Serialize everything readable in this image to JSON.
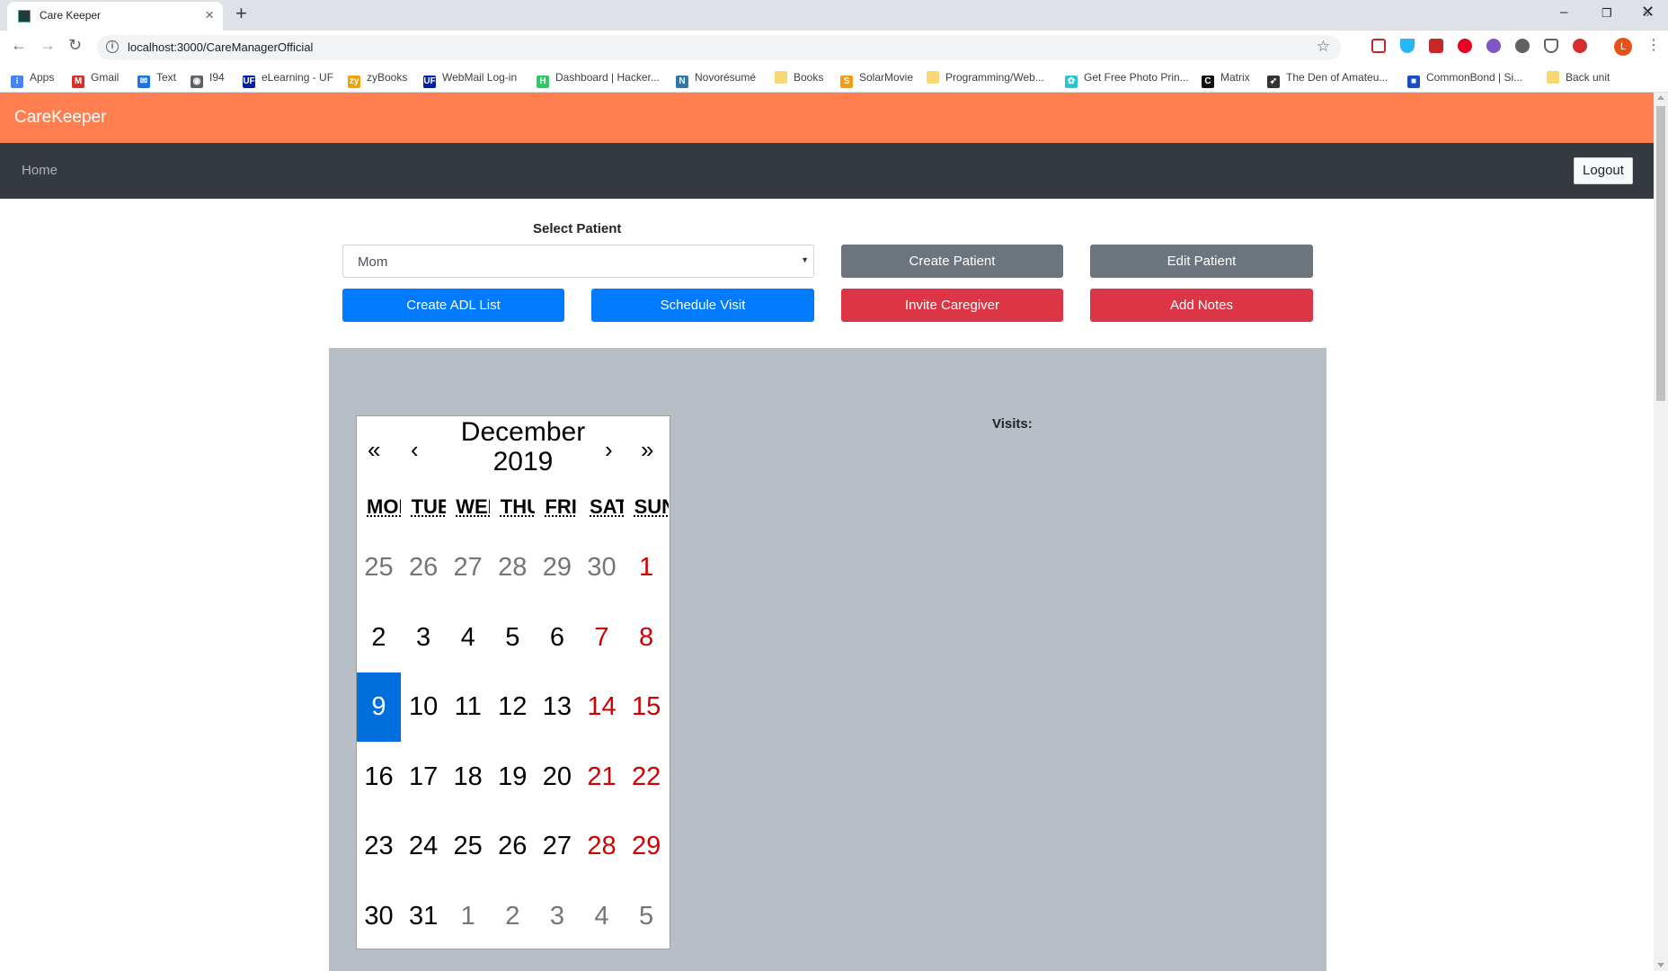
{
  "browser": {
    "tab_title": "Care Keeper",
    "url": "localhost:3000/CareManagerOfficial",
    "profile_initial": "L",
    "bookmarks": [
      {
        "label": "Apps",
        "icon": "apps-grid-icon",
        "color": "#4285f4"
      },
      {
        "label": "Gmail",
        "icon": "gmail-icon",
        "color": "#d93025"
      },
      {
        "label": "Text",
        "icon": "text-icon",
        "color": "#1a73e8"
      },
      {
        "label": "I94",
        "icon": "globe-icon",
        "color": "#5f6368"
      },
      {
        "label": "eLearning - UF",
        "icon": "uf-icon",
        "color": "#0021a5"
      },
      {
        "label": "zyBooks",
        "icon": "zybooks-icon",
        "color": "#f4a100"
      },
      {
        "label": "WebMail Log-in",
        "icon": "uf-icon",
        "color": "#0021a5"
      },
      {
        "label": "Dashboard | Hacker...",
        "icon": "hackerrank-icon",
        "color": "#2ec866"
      },
      {
        "label": "Novorésumé",
        "icon": "novoresume-icon",
        "color": "#2a7ab0"
      },
      {
        "label": "Books",
        "icon": "folder-icon",
        "color": "#f8d775"
      },
      {
        "label": "SolarMovie",
        "icon": "solarmovie-icon",
        "color": "#f39c12"
      },
      {
        "label": "Programming/Web...",
        "icon": "folder-icon",
        "color": "#f8d775"
      },
      {
        "label": "Get Free Photo Prin...",
        "icon": "photo-icon",
        "color": "#26c6da"
      },
      {
        "label": "Matrix",
        "icon": "matrix-icon",
        "color": "#111111"
      },
      {
        "label": "The Den of Amateu...",
        "icon": "bird-icon",
        "color": "#333333"
      },
      {
        "label": "CommonBond | Si...",
        "icon": "commonbond-icon",
        "color": "#1a4fc4"
      },
      {
        "label": "Back unit",
        "icon": "folder-icon",
        "color": "#f8d775"
      }
    ]
  },
  "app": {
    "brand": "CareKeeper",
    "nav_home": "Home",
    "logout": "Logout",
    "brand_color": "#ff7f50"
  },
  "controls": {
    "select_label": "Select Patient",
    "selected_patient": "Mom",
    "buttons": {
      "create_patient": "Create Patient",
      "edit_patient": "Edit Patient",
      "create_adl": "Create ADL List",
      "schedule_visit": "Schedule Visit",
      "invite_caregiver": "Invite Caregiver",
      "add_notes": "Add Notes"
    }
  },
  "visits_label": "Visits:",
  "calendar": {
    "nav": {
      "prev2": "«",
      "prev": "‹",
      "next": "›",
      "next2": "»"
    },
    "month": "December",
    "year": "2019",
    "weekdays": [
      "MON",
      "TUE",
      "WED",
      "THU",
      "FRI",
      "SAT",
      "SUN"
    ],
    "weeks": [
      [
        {
          "d": "25",
          "t": "neighbor"
        },
        {
          "d": "26",
          "t": "neighbor"
        },
        {
          "d": "27",
          "t": "neighbor"
        },
        {
          "d": "28",
          "t": "neighbor"
        },
        {
          "d": "29",
          "t": "neighbor"
        },
        {
          "d": "30",
          "t": "neighbor"
        },
        {
          "d": "1",
          "t": "weekend"
        }
      ],
      [
        {
          "d": "2",
          "t": ""
        },
        {
          "d": "3",
          "t": ""
        },
        {
          "d": "4",
          "t": ""
        },
        {
          "d": "5",
          "t": ""
        },
        {
          "d": "6",
          "t": ""
        },
        {
          "d": "7",
          "t": "weekend"
        },
        {
          "d": "8",
          "t": "weekend"
        }
      ],
      [
        {
          "d": "9",
          "t": "active"
        },
        {
          "d": "10",
          "t": ""
        },
        {
          "d": "11",
          "t": ""
        },
        {
          "d": "12",
          "t": ""
        },
        {
          "d": "13",
          "t": ""
        },
        {
          "d": "14",
          "t": "weekend"
        },
        {
          "d": "15",
          "t": "weekend"
        }
      ],
      [
        {
          "d": "16",
          "t": ""
        },
        {
          "d": "17",
          "t": ""
        },
        {
          "d": "18",
          "t": ""
        },
        {
          "d": "19",
          "t": ""
        },
        {
          "d": "20",
          "t": ""
        },
        {
          "d": "21",
          "t": "weekend"
        },
        {
          "d": "22",
          "t": "weekend"
        }
      ],
      [
        {
          "d": "23",
          "t": ""
        },
        {
          "d": "24",
          "t": ""
        },
        {
          "d": "25",
          "t": ""
        },
        {
          "d": "26",
          "t": ""
        },
        {
          "d": "27",
          "t": ""
        },
        {
          "d": "28",
          "t": "weekend"
        },
        {
          "d": "29",
          "t": "weekend"
        }
      ],
      [
        {
          "d": "30",
          "t": ""
        },
        {
          "d": "31",
          "t": ""
        },
        {
          "d": "1",
          "t": "neighbor"
        },
        {
          "d": "2",
          "t": "neighbor"
        },
        {
          "d": "3",
          "t": "neighbor"
        },
        {
          "d": "4",
          "t": "neighbor"
        },
        {
          "d": "5",
          "t": "neighbor"
        }
      ]
    ]
  }
}
